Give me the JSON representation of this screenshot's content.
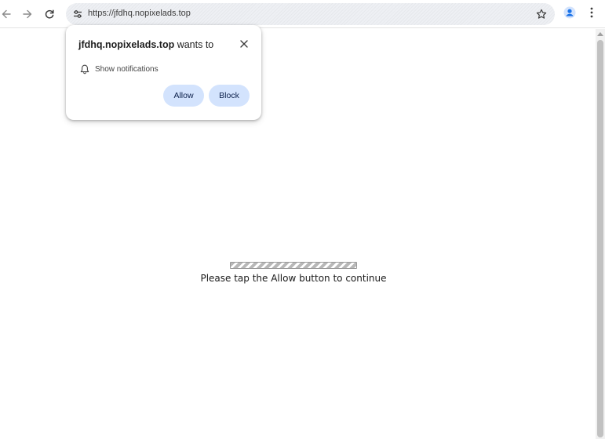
{
  "browser": {
    "url": "https://jfdhq.nopixelads.top"
  },
  "permission_popup": {
    "site": "jfdhq.nopixelads.top",
    "wants_to": " wants to",
    "permission": "Show notifications",
    "allow_label": "Allow",
    "block_label": "Block"
  },
  "page": {
    "message": "Please tap the Allow button to continue"
  },
  "colors": {
    "button_bg": "#d3e3fd",
    "profile_accent": "#1a73e8",
    "omnibox_bg": "#eef0f4"
  }
}
